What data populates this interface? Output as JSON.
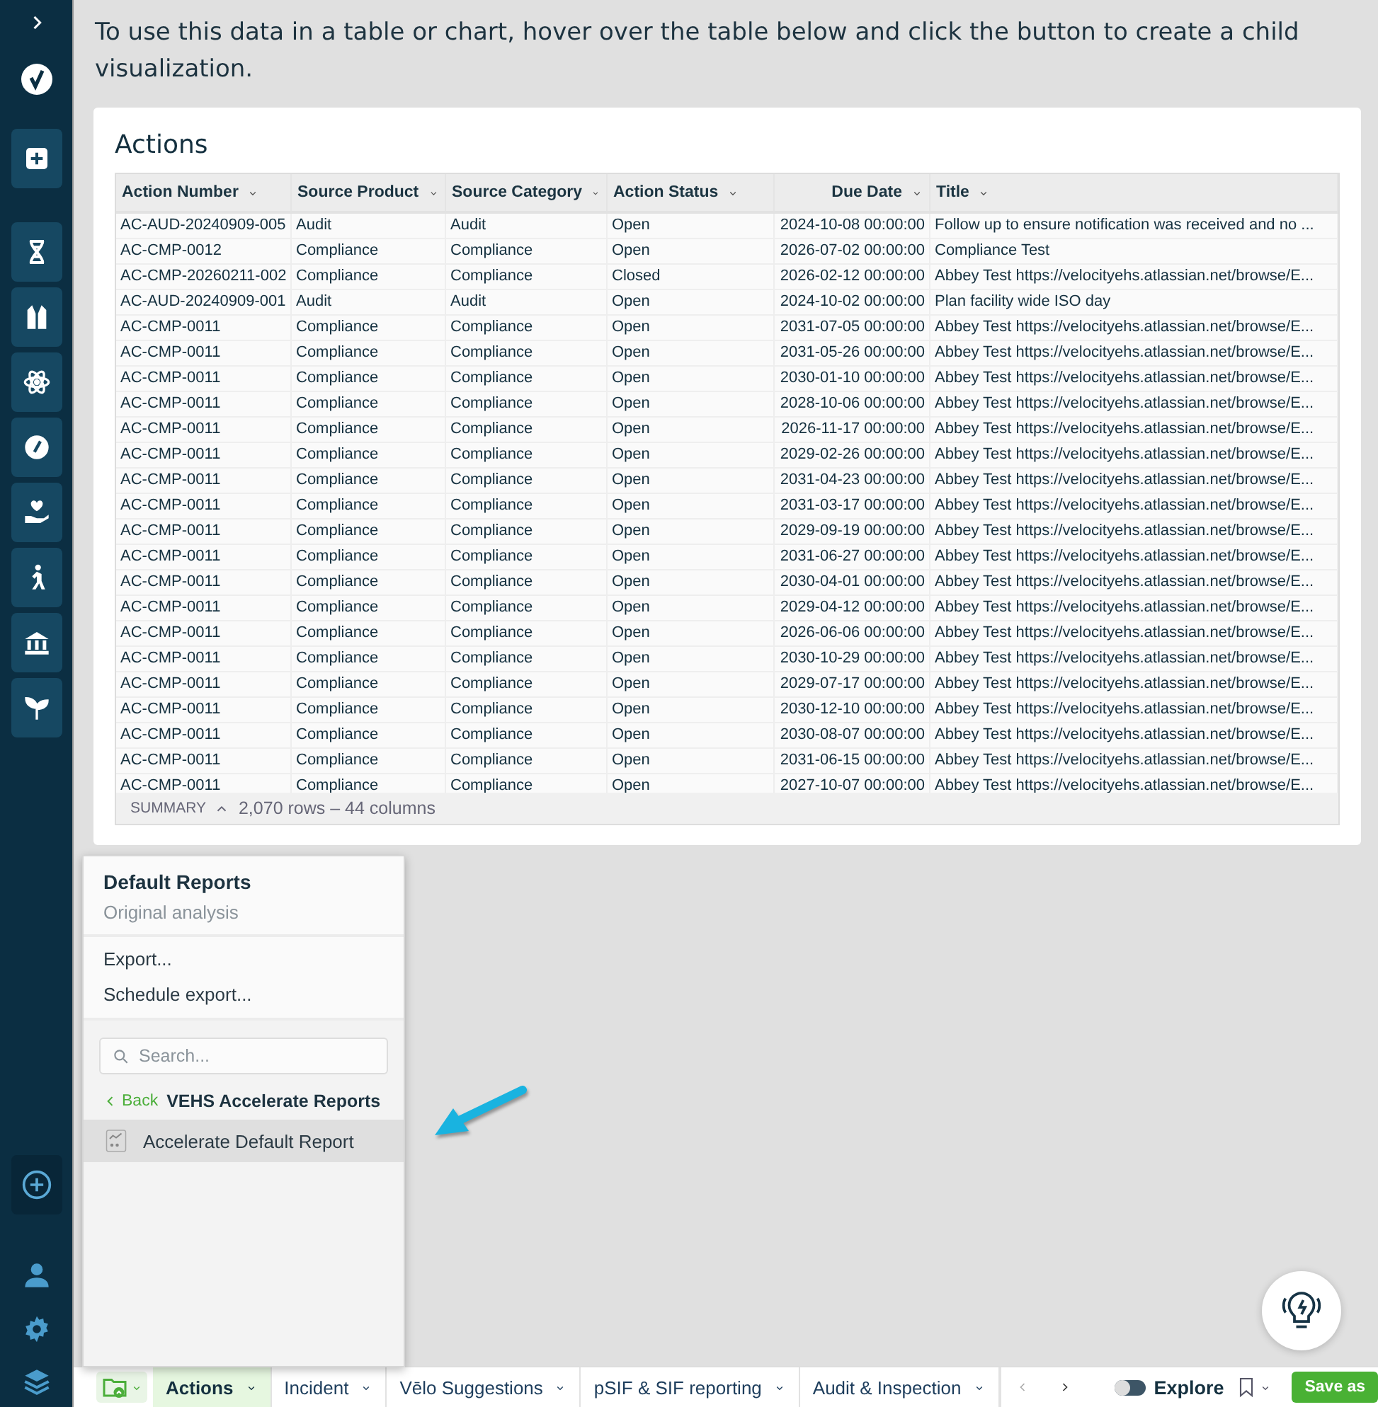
{
  "intro": "To use this data in a table or chart, hover over the table below and click the button to create a child visualization.",
  "card": {
    "title": "Actions",
    "columns": [
      "Action Number",
      "Source Product",
      "Source Category",
      "Action Status",
      "Due Date",
      "Title"
    ],
    "rows": [
      [
        "AC-AUD-20240909-005",
        "Audit",
        "Audit",
        "Open",
        "2024-10-08 00:00:00",
        "Follow up to ensure notification was received and no ..."
      ],
      [
        "AC-CMP-0012",
        "Compliance",
        "Compliance",
        "Open",
        "2026-07-02 00:00:00",
        "Compliance Test"
      ],
      [
        "AC-CMP-20260211-002",
        "Compliance",
        "Compliance",
        "Closed",
        "2026-02-12 00:00:00",
        "Abbey Test https://velocityehs.atlassian.net/browse/E..."
      ],
      [
        "AC-AUD-20240909-001",
        "Audit",
        "Audit",
        "Open",
        "2024-10-02 00:00:00",
        "Plan facility wide ISO day"
      ],
      [
        "AC-CMP-0011",
        "Compliance",
        "Compliance",
        "Open",
        "2031-07-05 00:00:00",
        "Abbey Test https://velocityehs.atlassian.net/browse/E..."
      ],
      [
        "AC-CMP-0011",
        "Compliance",
        "Compliance",
        "Open",
        "2031-05-26 00:00:00",
        "Abbey Test https://velocityehs.atlassian.net/browse/E..."
      ],
      [
        "AC-CMP-0011",
        "Compliance",
        "Compliance",
        "Open",
        "2030-01-10 00:00:00",
        "Abbey Test https://velocityehs.atlassian.net/browse/E..."
      ],
      [
        "AC-CMP-0011",
        "Compliance",
        "Compliance",
        "Open",
        "2028-10-06 00:00:00",
        "Abbey Test https://velocityehs.atlassian.net/browse/E..."
      ],
      [
        "AC-CMP-0011",
        "Compliance",
        "Compliance",
        "Open",
        "2026-11-17 00:00:00",
        "Abbey Test https://velocityehs.atlassian.net/browse/E..."
      ],
      [
        "AC-CMP-0011",
        "Compliance",
        "Compliance",
        "Open",
        "2029-02-26 00:00:00",
        "Abbey Test https://velocityehs.atlassian.net/browse/E..."
      ],
      [
        "AC-CMP-0011",
        "Compliance",
        "Compliance",
        "Open",
        "2031-04-23 00:00:00",
        "Abbey Test https://velocityehs.atlassian.net/browse/E..."
      ],
      [
        "AC-CMP-0011",
        "Compliance",
        "Compliance",
        "Open",
        "2031-03-17 00:00:00",
        "Abbey Test https://velocityehs.atlassian.net/browse/E..."
      ],
      [
        "AC-CMP-0011",
        "Compliance",
        "Compliance",
        "Open",
        "2029-09-19 00:00:00",
        "Abbey Test https://velocityehs.atlassian.net/browse/E..."
      ],
      [
        "AC-CMP-0011",
        "Compliance",
        "Compliance",
        "Open",
        "2031-06-27 00:00:00",
        "Abbey Test https://velocityehs.atlassian.net/browse/E..."
      ],
      [
        "AC-CMP-0011",
        "Compliance",
        "Compliance",
        "Open",
        "2030-04-01 00:00:00",
        "Abbey Test https://velocityehs.atlassian.net/browse/E..."
      ],
      [
        "AC-CMP-0011",
        "Compliance",
        "Compliance",
        "Open",
        "2029-04-12 00:00:00",
        "Abbey Test https://velocityehs.atlassian.net/browse/E..."
      ],
      [
        "AC-CMP-0011",
        "Compliance",
        "Compliance",
        "Open",
        "2026-06-06 00:00:00",
        "Abbey Test https://velocityehs.atlassian.net/browse/E..."
      ],
      [
        "AC-CMP-0011",
        "Compliance",
        "Compliance",
        "Open",
        "2030-10-29 00:00:00",
        "Abbey Test https://velocityehs.atlassian.net/browse/E..."
      ],
      [
        "AC-CMP-0011",
        "Compliance",
        "Compliance",
        "Open",
        "2029-07-17 00:00:00",
        "Abbey Test https://velocityehs.atlassian.net/browse/E..."
      ],
      [
        "AC-CMP-0011",
        "Compliance",
        "Compliance",
        "Open",
        "2030-12-10 00:00:00",
        "Abbey Test https://velocityehs.atlassian.net/browse/E..."
      ],
      [
        "AC-CMP-0011",
        "Compliance",
        "Compliance",
        "Open",
        "2030-08-07 00:00:00",
        "Abbey Test https://velocityehs.atlassian.net/browse/E..."
      ],
      [
        "AC-CMP-0011",
        "Compliance",
        "Compliance",
        "Open",
        "2031-06-15 00:00:00",
        "Abbey Test https://velocityehs.atlassian.net/browse/E..."
      ],
      [
        "AC-CMP-0011",
        "Compliance",
        "Compliance",
        "Open",
        "2027-10-07 00:00:00",
        "Abbey Test https://velocityehs.atlassian.net/browse/E..."
      ]
    ],
    "summary": {
      "label": "SUMMARY",
      "text": "2,070 rows – 44 columns"
    }
  },
  "menu": {
    "title": "Default Reports",
    "subtitle": "Original analysis",
    "actions": [
      "Export...",
      "Schedule export..."
    ],
    "search": {
      "placeholder": "Search..."
    },
    "back": "Back",
    "folder": "VEHS Accelerate Reports",
    "reports": [
      {
        "label": "Accelerate Default Report",
        "selected": true
      }
    ]
  },
  "tabs": [
    {
      "label": "Actions",
      "selected": true
    },
    {
      "label": "Incident",
      "selected": false
    },
    {
      "label": "Vēlo Suggestions",
      "selected": false
    },
    {
      "label": "pSIF & SIF reporting",
      "selected": false
    },
    {
      "label": "Audit & Inspection",
      "selected": false
    }
  ],
  "explore": {
    "label": "Explore",
    "on": false
  },
  "save": "Save as"
}
